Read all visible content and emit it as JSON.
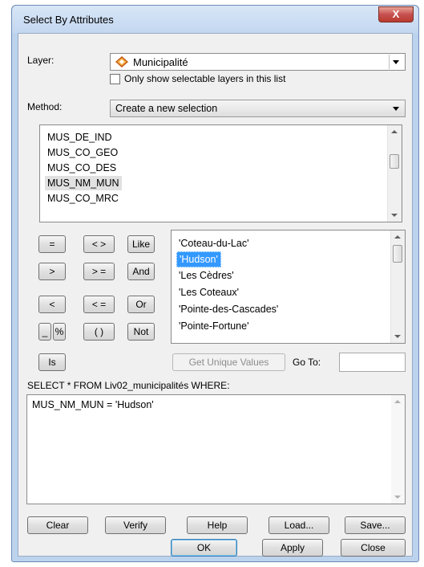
{
  "window": {
    "title": "Select By Attributes",
    "close_glyph": "X"
  },
  "layer": {
    "label": "Layer:",
    "value": "Municipalité",
    "icon": "diamond-layer-icon",
    "only_selectable_label": "Only show selectable layers in this list",
    "only_selectable_checked": false
  },
  "method": {
    "label": "Method:",
    "value": "Create a new selection"
  },
  "fields": {
    "items": [
      "MUS_DE_IND",
      "MUS_CO_GEO",
      "MUS_CO_DES",
      "MUS_NM_MUN",
      "MUS_CO_MRC"
    ],
    "selected": "MUS_NM_MUN"
  },
  "operators": [
    "=",
    "< >",
    "Like",
    ">",
    "> =",
    "And",
    "<",
    "< =",
    "Or",
    "_",
    "%",
    "( )",
    "Not",
    "Is"
  ],
  "values": {
    "items": [
      "'Coteau-du-Lac'",
      "'Hudson'",
      "'Les Cèdres'",
      "'Les Coteaux'",
      "'Pointe-des-Cascades'",
      "'Pointe-Fortune'"
    ],
    "selected": "'Hudson'"
  },
  "get_unique": {
    "label": "Get Unique Values",
    "goto_label": "Go To:",
    "goto_value": ""
  },
  "query": {
    "prefix": "SELECT * FROM Liv02_municipalités WHERE:",
    "text": "MUS_NM_MUN = 'Hudson'"
  },
  "action_buttons": {
    "clear": "Clear",
    "verify": "Verify",
    "help": "Help",
    "load": "Load...",
    "save": "Save..."
  },
  "dialog_buttons": {
    "ok": "OK",
    "apply": "Apply",
    "close": "Close"
  }
}
